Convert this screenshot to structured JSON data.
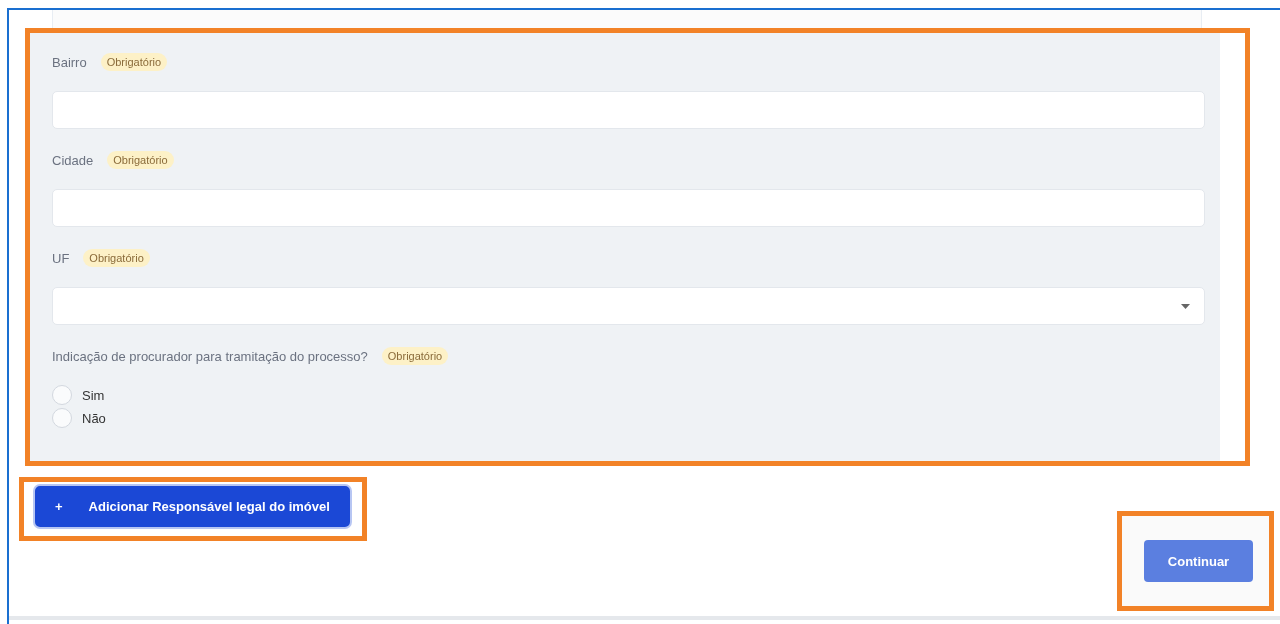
{
  "fields": [
    {
      "kind": "text",
      "label": "Bairro",
      "badge": "Obrigatório"
    },
    {
      "kind": "text",
      "label": "Cidade",
      "badge": "Obrigatório"
    },
    {
      "kind": "select",
      "label": "UF",
      "badge": "Obrigatório"
    }
  ],
  "question": {
    "label": "Indicação de procurador para tramitação do processo?",
    "badge": "Obrigatório",
    "options": [
      {
        "label": "Sim",
        "selected": false
      },
      {
        "label": "Não",
        "selected": false
      }
    ]
  },
  "add_button": {
    "icon": "+",
    "label": "Adicionar Responsável legal do imóvel"
  },
  "continue_button": {
    "label": "Continuar",
    "disabled": true
  }
}
